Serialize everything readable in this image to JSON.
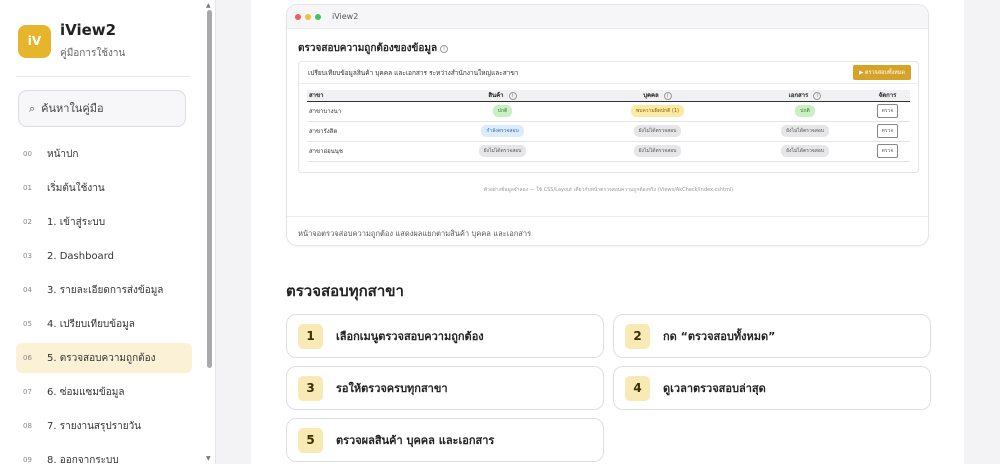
{
  "sidebar": {
    "logo_text": "iV",
    "title": "iView2",
    "subtitle": "คู่มือการใช้งาน",
    "search_placeholder": "ค้นหาในคู่มือ",
    "items": [
      {
        "num": "00",
        "label": "หน้าปก"
      },
      {
        "num": "01",
        "label": "เริ่มต้นใช้งาน"
      },
      {
        "num": "02",
        "label": "1. เข้าสู่ระบบ"
      },
      {
        "num": "03",
        "label": "2. Dashboard"
      },
      {
        "num": "04",
        "label": "3. รายละเอียดการส่งข้อมูล"
      },
      {
        "num": "05",
        "label": "4. เปรียบเทียบข้อมูล"
      },
      {
        "num": "06",
        "label": "5. ตรวจสอบความถูกต้อง",
        "active": true
      },
      {
        "num": "07",
        "label": "6. ซ่อมแซมข้อมูล"
      },
      {
        "num": "08",
        "label": "7. รายงานสรุปรายวัน"
      },
      {
        "num": "09",
        "label": "8. ออกจากระบบ"
      }
    ]
  },
  "preview": {
    "window_title": "iView2",
    "heading": "ตรวจสอบความถูกต้องของข้อมูล",
    "description": "เปรียบเทียบข้อมูลสินค้า บุคคล และเอกสาร ระหว่างสำนักงานใหญ่และสาขา",
    "check_all_label": "▶ ตรวจสอบทั้งหมด",
    "columns": [
      "สาขา",
      "สินค้า",
      "บุคคล",
      "เอกสาร",
      "จัดการ"
    ],
    "rows": [
      {
        "branch": "สาขาบางนา",
        "product": "ปกติ",
        "person": "พบความผิดปกติ (1)",
        "document": "ปกติ",
        "action": "ตรวจ"
      },
      {
        "branch": "สาขารังสิต",
        "product": "กำลังตรวจสอบ",
        "person": "ยังไม่ได้ตรวจสอบ",
        "document": "ยังไม่ได้ตรวจสอบ",
        "action": "ตรวจ"
      },
      {
        "branch": "สาขาอ่อนนุช",
        "product": "ยังไม่ได้ตรวจสอบ",
        "person": "ยังไม่ได้ตรวจสอบ",
        "document": "ยังไม่ได้ตรวจสอบ",
        "action": "ตรวจ"
      }
    ],
    "footnote": "ตัวอย่างข้อมูลจำลอง — ใช้ CSS/Layout เดียวกับหน้าตรวจสอบความถูกต้องจริง (Views/AkCheck/Index.cshtml)",
    "caption": "หน้าจอตรวจสอบความถูกต้อง แสดงผลแยกตามสินค้า บุคคล และเอกสาร"
  },
  "section": {
    "title": "ตรวจสอบทุกสาขา",
    "steps": [
      {
        "num": "1",
        "label": "เลือกเมนูตรวจสอบความถูกต้อง"
      },
      {
        "num": "2",
        "label": "กด “ตรวจสอบทั้งหมด”"
      },
      {
        "num": "3",
        "label": "รอให้ตรวจครบทุกสาขา"
      },
      {
        "num": "4",
        "label": "ดูเวลาตรวจสอบล่าสุด"
      },
      {
        "num": "5",
        "label": "ตรวจผลสินค้า บุคคล และเอกสาร"
      }
    ]
  },
  "colors": {
    "accent": "#e7b52c",
    "active_bg": "#fbf1d6",
    "step_badge": "#f9e9b4"
  }
}
